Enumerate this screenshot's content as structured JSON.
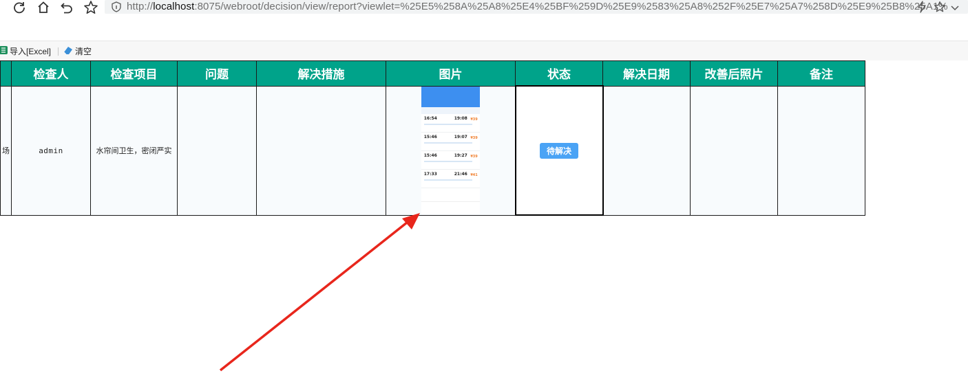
{
  "browser": {
    "url_prefix": "http://",
    "url_host": "localhost",
    "url_rest": ":8075/webroot/decision/view/report?viewlet=%25E5%258A%25A8%25E4%25BF%259D%25E9%2583%25A8%252F%25E7%25A7%258D%25E9%25B8%25A1%"
  },
  "toolbar": {
    "import_label": "导入[Excel]",
    "clear_label": "清空"
  },
  "table": {
    "headers": [
      "检查人",
      "检查项目",
      "问题",
      "解决措施",
      "图片",
      "状态",
      "解决日期",
      "改善后照片",
      "备注"
    ],
    "row": {
      "first_cell_fragment": "场",
      "inspector": "admin",
      "item": "水帘间卫生，密闭严实",
      "problem": "",
      "measure": "",
      "status": "待解决",
      "resolve_date": "",
      "after_photo": "",
      "remark": ""
    }
  },
  "phone_thumb": {
    "rows": [
      {
        "t1": "16:54",
        "t2": "19:08",
        "price": "¥39"
      },
      {
        "t1": "15:46",
        "t2": "19:07",
        "price": "¥39"
      },
      {
        "t1": "15:46",
        "t2": "19:27",
        "price": "¥39"
      },
      {
        "t1": "17:33",
        "t2": "21:46",
        "price": "¥41"
      }
    ]
  },
  "colors": {
    "header_bg": "#00a38a",
    "status_btn": "#4aa3f5",
    "arrow": "#e8261c"
  }
}
